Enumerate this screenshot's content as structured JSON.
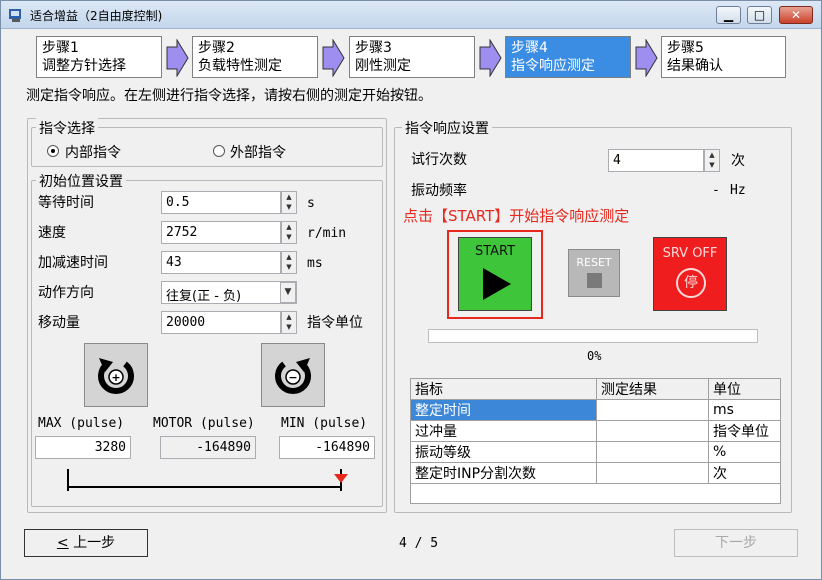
{
  "window": {
    "title": "适合增益（2自由度控制)"
  },
  "steps": [
    {
      "num": "步骤1",
      "label": "调整方针选择"
    },
    {
      "num": "步骤2",
      "label": "负载特性测定"
    },
    {
      "num": "步骤3",
      "label": "刚性测定"
    },
    {
      "num": "步骤4",
      "label": "指令响应测定"
    },
    {
      "num": "步骤5",
      "label": "结果确认"
    }
  ],
  "instruction": "测定指令响应。在左侧进行指令选择，请按右侧的测定开始按钮。",
  "command_select": {
    "title": "指令选择",
    "internal": "内部指令",
    "external": "外部指令",
    "selected": "internal"
  },
  "init_pos": {
    "title": "初始位置设置",
    "rows": [
      {
        "label": "等待时间",
        "value": "0.5",
        "unit": "s"
      },
      {
        "label": "速度",
        "value": "2752",
        "unit": "r/min"
      },
      {
        "label": "加减速时间",
        "value": "43",
        "unit": "ms"
      },
      {
        "label": "动作方向",
        "value": "往复(正 - 负)",
        "unit": ""
      },
      {
        "label": "移动量",
        "value": "20000",
        "unit": "指令单位"
      }
    ],
    "max_label": "MAX (pulse)",
    "motor_label": "MOTOR (pulse)",
    "min_label": "MIN (pulse)",
    "max_value": "3280",
    "motor_value": "-164890",
    "min_value": "-164890"
  },
  "response": {
    "title": "指令响应设置",
    "trials_label": "试行次数",
    "trials_value": "4",
    "trials_unit": "次",
    "vib_label": "振动频率",
    "vib_value": "-",
    "vib_unit": "Hz",
    "hint": "点击【START】开始指令响应测定",
    "hint_color": "#e8281c",
    "start_label": "START",
    "reset_label": "RESET",
    "srvoff_label": "SRV OFF",
    "srvoff_stop": "停",
    "progress_percent": 0,
    "progress_text": "0%"
  },
  "results": {
    "headers": [
      "指标",
      "测定结果",
      "单位"
    ],
    "rows": [
      {
        "name": "整定时间",
        "value": "",
        "unit": "ms"
      },
      {
        "name": "过冲量",
        "value": "",
        "unit": "指令单位"
      },
      {
        "name": "振动等级",
        "value": "",
        "unit": "%"
      },
      {
        "name": "整定时INP分割次数",
        "value": "",
        "unit": "次"
      }
    ]
  },
  "footer": {
    "prev_label": "上一步",
    "prev_mnemonic": "<",
    "page_indicator": "4 / 5",
    "next_label": "下一步"
  }
}
